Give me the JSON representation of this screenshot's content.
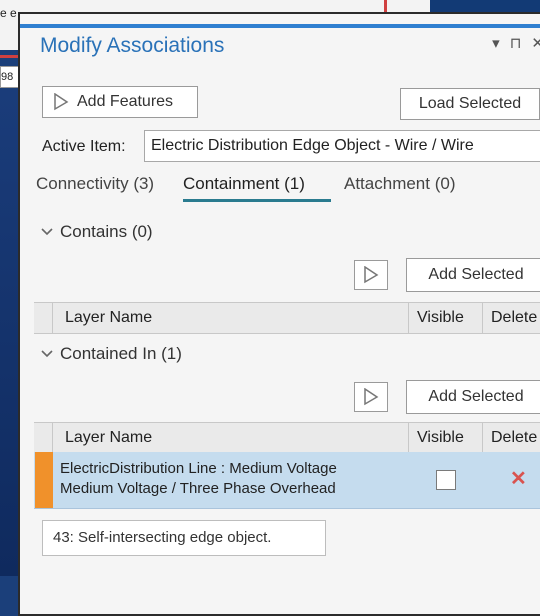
{
  "background": {
    "text_fragment": "e e",
    "input_fragment": "98"
  },
  "panel": {
    "title": "Modify Associations",
    "controls": [
      "▾",
      "⊓",
      "✕"
    ],
    "add_features_label": "Add Features",
    "load_selected_label": "Load Selected",
    "active_item_label": "Active Item:",
    "active_item_value": "Electric Distribution Edge Object - Wire / Wire",
    "tabs": [
      {
        "label": "Connectivity (3)",
        "selected": false
      },
      {
        "label": "Containment (1)",
        "selected": true
      },
      {
        "label": "Attachment (0)",
        "selected": false
      }
    ],
    "contains": {
      "header": "Contains (0)",
      "add_selected_label": "Add Selected",
      "columns": [
        "Layer Name",
        "Visible",
        "Delete"
      ]
    },
    "contained_in": {
      "header": "Contained In (1)",
      "add_selected_label": "Add Selected",
      "columns": [
        "Layer Name",
        "Visible",
        "Delete"
      ],
      "rows": [
        {
          "line1": "ElectricDistribution Line : Medium Voltage",
          "line2": "Medium Voltage / Three Phase Overhead",
          "visible": false
        }
      ]
    },
    "message": "43: Self-intersecting edge object."
  },
  "colors": {
    "title": "#2a72b8",
    "tab_underline": "#2a7b8f",
    "row_selected": "#c5dcee",
    "row_marker": "#f0912b",
    "delete_x": "#d9534f"
  }
}
